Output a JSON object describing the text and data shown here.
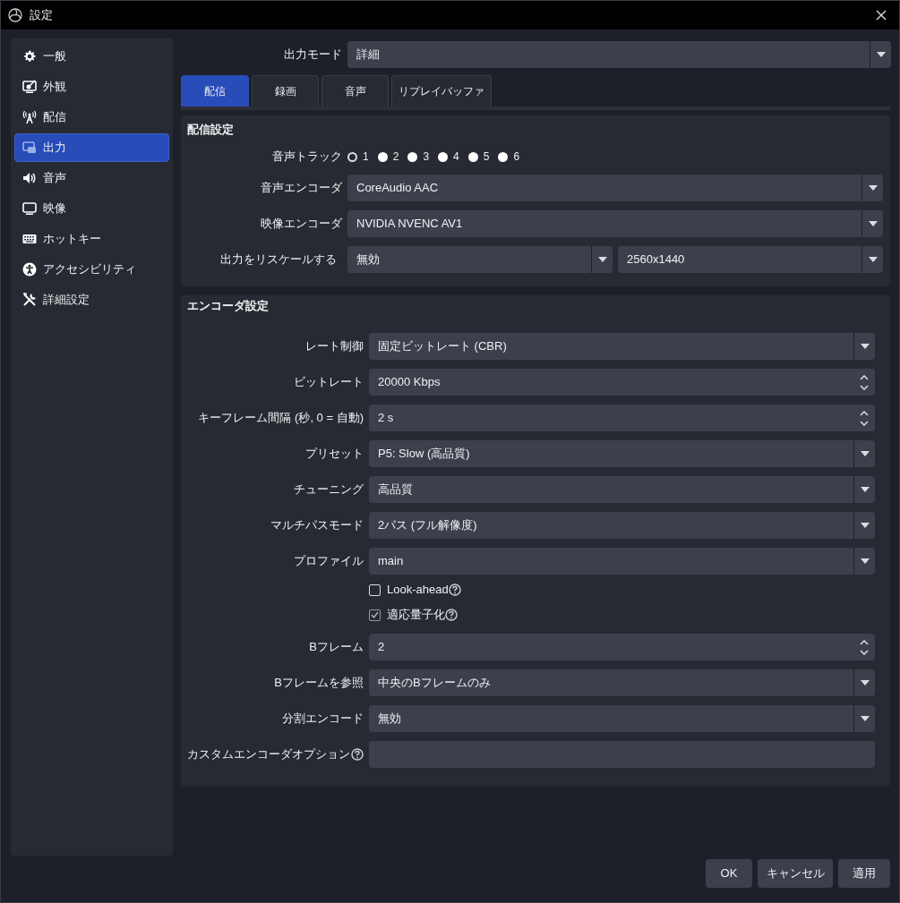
{
  "window": {
    "title": "設定"
  },
  "sidebar": {
    "items": [
      {
        "label": "一般",
        "selected": false
      },
      {
        "label": "外観",
        "selected": false
      },
      {
        "label": "配信",
        "selected": false
      },
      {
        "label": "出力",
        "selected": true
      },
      {
        "label": "音声",
        "selected": false
      },
      {
        "label": "映像",
        "selected": false
      },
      {
        "label": "ホットキー",
        "selected": false
      },
      {
        "label": "アクセシビリティ",
        "selected": false
      },
      {
        "label": "詳細設定",
        "selected": false
      }
    ]
  },
  "output_mode": {
    "label": "出力モード",
    "value": "詳細"
  },
  "tabs": [
    {
      "label": "配信",
      "selected": true
    },
    {
      "label": "録画",
      "selected": false
    },
    {
      "label": "音声",
      "selected": false
    },
    {
      "label": "リプレイバッファ",
      "selected": false
    }
  ],
  "stream_settings": {
    "title": "配信設定",
    "audio_track": {
      "label": "音声トラック",
      "options": [
        {
          "label": "1",
          "selected": true
        },
        {
          "label": "2",
          "selected": false
        },
        {
          "label": "3",
          "selected": false
        },
        {
          "label": "4",
          "selected": false
        },
        {
          "label": "5",
          "selected": false
        },
        {
          "label": "6",
          "selected": false
        }
      ]
    },
    "audio_encoder": {
      "label": "音声エンコーダ",
      "value": "CoreAudio AAC"
    },
    "video_encoder": {
      "label": "映像エンコーダ",
      "value": "NVIDIA NVENC AV1"
    },
    "rescale": {
      "label": "出力をリスケールする",
      "value": "無効",
      "resolution": "2560x1440"
    }
  },
  "encoder_settings": {
    "title": "エンコーダ設定",
    "rows": [
      {
        "kind": "select",
        "label": "レート制御",
        "value": "固定ビットレート (CBR)"
      },
      {
        "kind": "spin",
        "label": "ビットレート",
        "value": "20000 Kbps"
      },
      {
        "kind": "spin",
        "label": "キーフレーム間隔 (秒, 0 = 自動)",
        "value": "2 s"
      },
      {
        "kind": "select",
        "label": "プリセット",
        "value": "P5: Slow (高品質)"
      },
      {
        "kind": "select",
        "label": "チューニング",
        "value": "高品質"
      },
      {
        "kind": "select",
        "label": "マルチパスモード",
        "value": "2パス (フル解像度)"
      },
      {
        "kind": "select",
        "label": "プロファイル",
        "value": "main"
      },
      {
        "kind": "checkbox",
        "label": "Look-ahead",
        "checked": false,
        "help": true
      },
      {
        "kind": "checkbox",
        "label": "適応量子化",
        "checked": true,
        "help": true
      },
      {
        "kind": "spin",
        "label": "Bフレーム",
        "value": "2"
      },
      {
        "kind": "select",
        "label": "Bフレームを参照",
        "value": "中央のBフレームのみ"
      },
      {
        "kind": "select",
        "label": "分割エンコード",
        "value": "無効"
      },
      {
        "kind": "text",
        "label": "カスタムエンコーダオプション",
        "help": true
      }
    ]
  },
  "buttons": [
    "OK",
    "キャンセル",
    "適用"
  ]
}
